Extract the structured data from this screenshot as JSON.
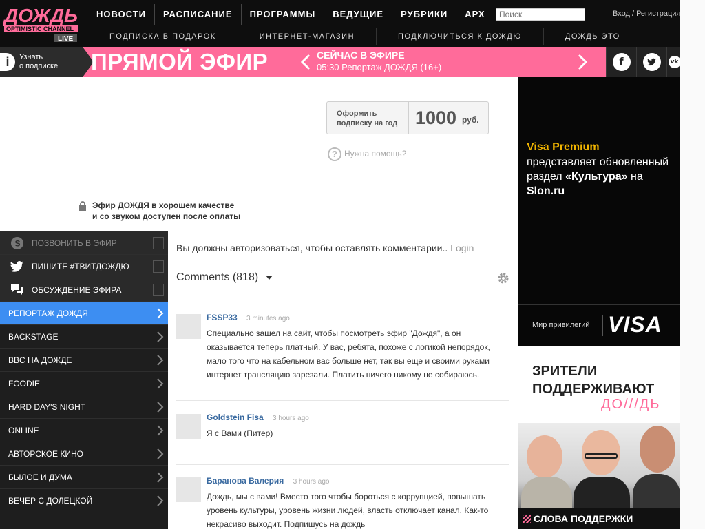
{
  "logo": {
    "main": "ДОЖДЬ",
    "tagline": "OPTIMISTIC CHANNEL",
    "live": "LIVE"
  },
  "nav_primary": [
    "НОВОСТИ",
    "РАСПИСАНИЕ",
    "ПРОГРАММЫ",
    "ВЕДУЩИЕ",
    "РУБРИКИ",
    "АРХ"
  ],
  "search": {
    "placeholder": "Поиск"
  },
  "auth": {
    "login": "Вход",
    "separator": "/",
    "register": "Регистрация"
  },
  "nav_secondary": [
    "ПОДПИСКА В ПОДАРОК",
    "ИНТЕРНЕТ-МАГАЗИН",
    "ПОДКЛЮЧИТЬСЯ К ДОЖДЮ",
    "ДОЖДЬ ЭТО"
  ],
  "liveband": {
    "info_line1": "Узнать",
    "info_line2": "о подписке",
    "title": "ПРЯМОЙ ЭФИР",
    "now_label": "СЕЙЧАС В ЭФИРЕ",
    "now_show": "05:30 Репортаж ДОЖДЯ (16+)",
    "social": [
      "f",
      "t",
      "vk"
    ]
  },
  "player": {
    "subscribe_line1": "Оформить",
    "subscribe_line2": "подписку на год",
    "price": "1000",
    "currency": "руб.",
    "help_icon": "?",
    "help": "Нужна помощь?",
    "quality_line1": "Эфир ДОЖДЯ в хорошем качестве",
    "quality_line2": "и со звуком доступен после оплаты"
  },
  "sidebar": {
    "social_items": [
      "ПОЗВОНИТЬ В ЭФИР",
      "ПИШИТЕ #ТВИТДОЖДЮ",
      "ОБСУЖДЕНИЕ ЭФИРА"
    ],
    "programs": [
      "РЕПОРТАЖ ДОЖДЯ",
      "BACKSTAGE",
      "BBC НА ДОЖДЕ",
      "FOODIE",
      "HARD DAY'S NIGHT",
      "ONLINE",
      "АВТОРСКОЕ КИНО",
      "БЫЛОЕ И ДУМА",
      "ВЕЧЕР С ДОЛЕЦКОЙ"
    ]
  },
  "comments": {
    "auth_msg": "Вы должны авторизоваться, чтобы оставлять комментарии..",
    "login": "Login",
    "count_label": "Comments",
    "count": "(818)",
    "items": [
      {
        "author": "FSSP33",
        "time": "3 minutes ago",
        "text": "Специально зашел на сайт, чтобы посмотреть эфир \"Дождя\", а он оказывается теперь платный. У вас, ребята, похоже с логикой непорядок, мало того что на кабельном вас больше нет, так вы еще и своими руками интернет трансляцию зарезали. Платить ничего никому не собираюсь."
      },
      {
        "author": "Goldstein Fisa",
        "time": "3 hours ago",
        "text": "Я с Вами (Питер)"
      },
      {
        "author": "Баранова Валерия",
        "time": "3 hours ago",
        "text": "Дождь, мы с вами! Вместо того чтобы бороться с коррупцией, повышать уровень культуры, уровень жизни людей, власть отключает канал. Как-то некрасиво выходит. Подпишусь на дождь"
      }
    ]
  },
  "ads": {
    "visa_head": "Visa Premium",
    "visa_text_1": "представляет обновленный раздел ",
    "visa_text_bold_1": "«Культура»",
    "visa_text_2": " на ",
    "visa_text_bold_2": "Slon.ru",
    "visa_mir": "Мир привилегий",
    "visa_logo": "VISA",
    "support_line1": "ЗРИТЕЛИ",
    "support_line2": "ПОДДЕРЖИВАЮТ",
    "support_brand": "ДО///ДЬ",
    "support_footer": "СЛОВА ПОДДЕРЖКИ"
  },
  "colors": {
    "accent_pink": "#ff6b9a",
    "active_blue": "#3d8ef2",
    "visa_gold": "#f0b400",
    "author_blue": "#3a6aa0"
  }
}
